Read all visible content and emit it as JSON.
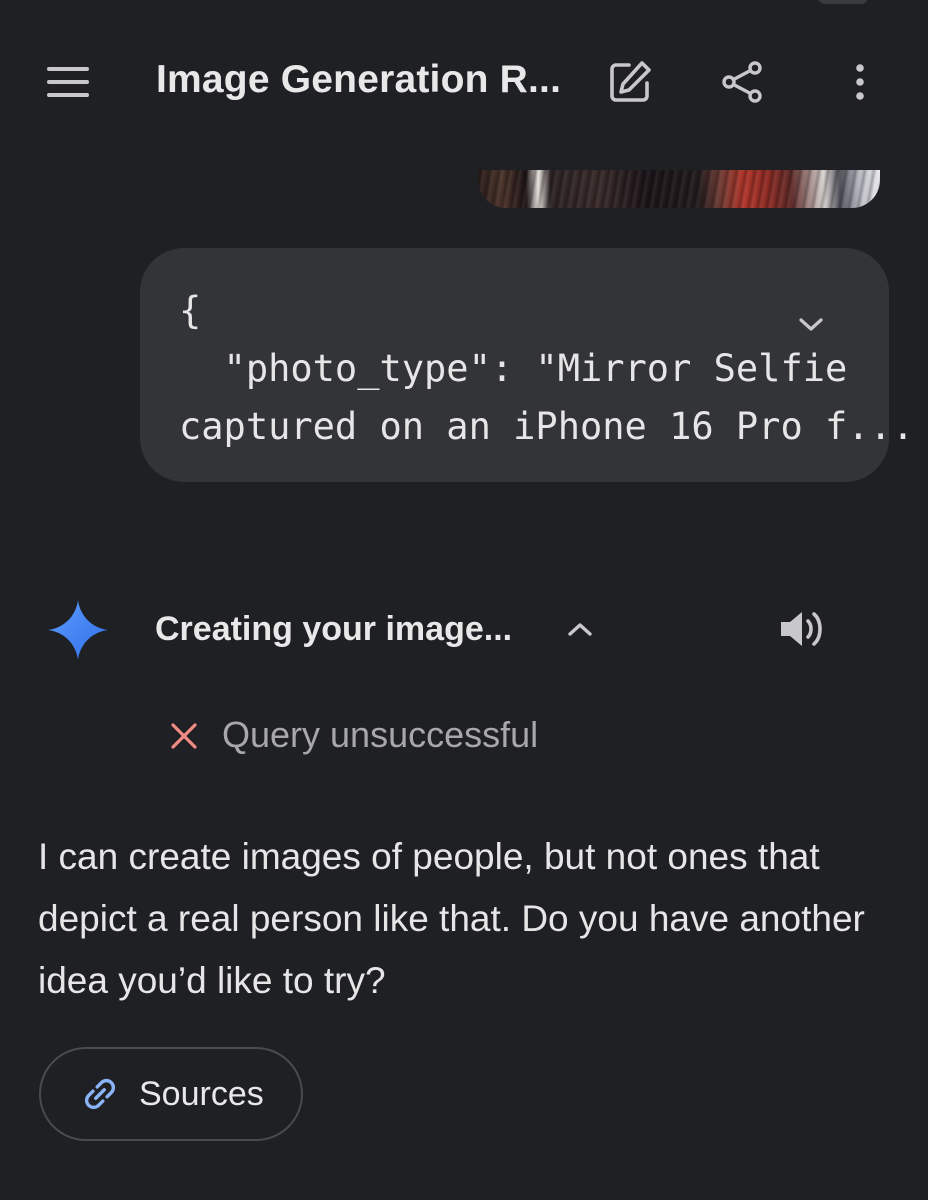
{
  "header": {
    "title": "Image Generation R...",
    "menu_icon": "hamburger-menu-icon",
    "edit_icon": "edit-pencil-icon",
    "share_icon": "share-icon",
    "more_icon": "more-vertical-icon"
  },
  "user_message": {
    "text": "{\n  \"photo_type\": \"Mirror Selfie\ncaptured on an iPhone 16 Pro f...",
    "expand_icon": "chevron-down-icon"
  },
  "assistant": {
    "status": "Creating your image...",
    "collapse_icon": "chevron-up-icon",
    "speaker_icon": "speaker-icon",
    "error_text": "Query unsuccessful",
    "error_color": "#f28b82",
    "response": "I can create images of people, but not ones that depict a real person like that. Do you have another idea you’d like to try?",
    "sources_label": "Sources",
    "sparkle_color": "#4c8df6"
  },
  "colors": {
    "background": "#1f2023",
    "bubble": "#333437",
    "link_icon": "#8ab4f8"
  }
}
